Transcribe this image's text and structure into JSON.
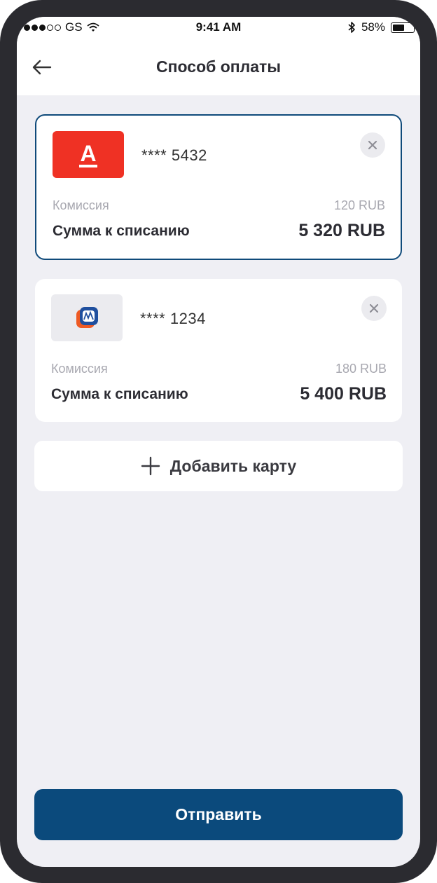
{
  "status_bar": {
    "carrier": "GS",
    "time": "9:41 AM",
    "battery": "58%",
    "battery_level": 0.58,
    "signal_bars_filled": 3,
    "signal_bars_total": 5
  },
  "header": {
    "title": "Способ оплаты",
    "back_icon": "arrow-left-icon"
  },
  "cards": [
    {
      "bank_icon": "alfa-bank-logo",
      "bank_logo_letter": "А",
      "number": "**** 5432",
      "fee_label": "Комиссия",
      "fee_value": "120 RUB",
      "total_label": "Сумма к списанию",
      "total_value": "5 320 RUB",
      "selected": true
    },
    {
      "bank_icon": "vtb-bank-logo",
      "number": "**** 1234",
      "fee_label": "Комиссия",
      "fee_value": "180 RUB",
      "total_label": "Сумма к списанию",
      "total_value": "5 400 RUB",
      "selected": false
    }
  ],
  "add_card": {
    "label": "Добавить карту",
    "icon": "plus-icon"
  },
  "submit": {
    "label": "Отправить"
  },
  "colors": {
    "accent": "#0b4a7c",
    "selected_border": "#0f4a7a",
    "alfa_red": "#ef3124",
    "background": "#efeff4",
    "muted_text": "#a8a8b0"
  }
}
